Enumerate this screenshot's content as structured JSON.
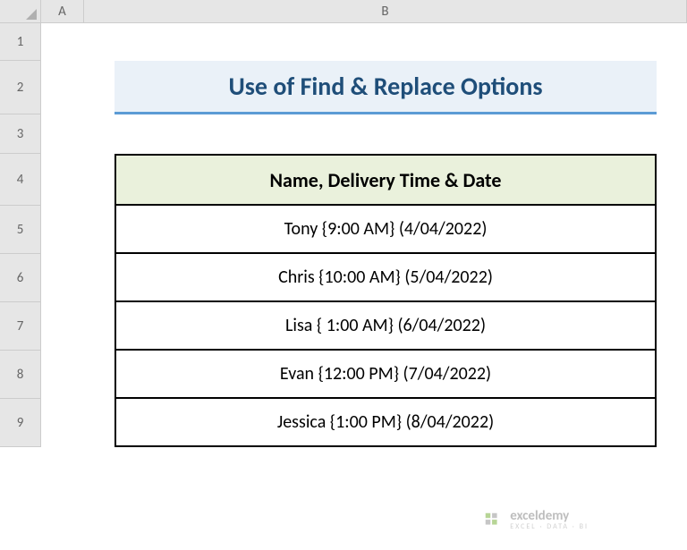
{
  "columns": {
    "a": "A",
    "b": "B"
  },
  "rows": {
    "r1": "1",
    "r2": "2",
    "r3": "3",
    "r4": "4",
    "r5": "5",
    "r6": "6",
    "r7": "7",
    "r8": "8",
    "r9": "9"
  },
  "title": "Use of Find & Replace Options",
  "table_header": "Name, Delivery Time & Date",
  "data": [
    "Tony {9:00 AM}  (4/04/2022)",
    "Chris {10:00 AM}  (5/04/2022)",
    "Lisa { 1:00 AM}  (6/04/2022)",
    "Evan {12:00 PM} (7/04/2022)",
    "Jessica {1:00 PM} (8/04/2022)"
  ],
  "watermark": {
    "brand": "exceldemy",
    "sub": "EXCEL · DATA · BI"
  }
}
